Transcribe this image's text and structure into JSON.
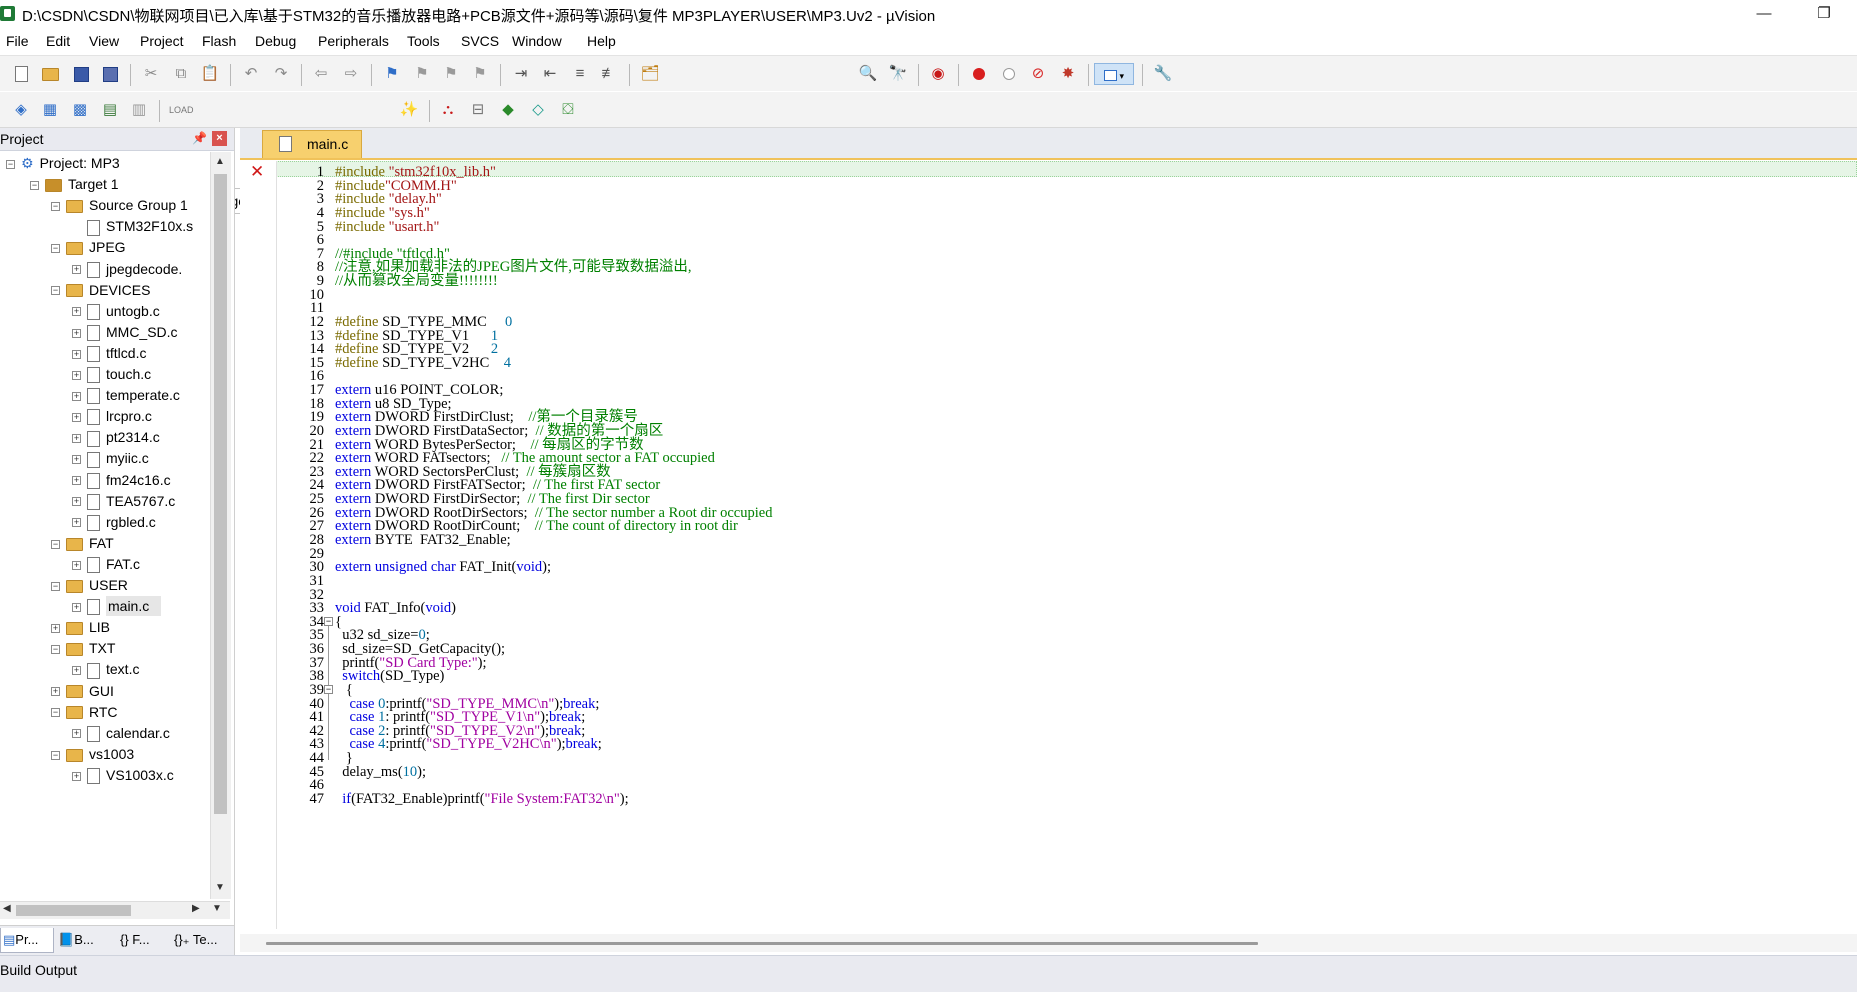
{
  "window": {
    "title": "D:\\CSDN\\CSDN\\物联网项目\\已入库\\基于STM32的音乐播放器电路+PCB源文件+源码等\\源码\\复件 MP3PLAYER\\USER\\MP3.Uv2 - µVision",
    "minimize": "—",
    "restore": "❐"
  },
  "menu": [
    "File",
    "Edit",
    "View",
    "Project",
    "Flash",
    "Debug",
    "Peripherals",
    "Tools",
    "SVCS",
    "Window",
    "Help"
  ],
  "toolbar2": {
    "target": "Target 1"
  },
  "project_panel": {
    "title": "Project",
    "pin": "📌",
    "close": "×",
    "tabs": [
      "Pr...",
      "B...",
      "{} F...",
      "{}₊ Te..."
    ],
    "tree": [
      {
        "label": "Project: MP3",
        "level": 0,
        "type": "project",
        "expander": "−"
      },
      {
        "label": "Target 1",
        "level": 1,
        "type": "target",
        "expander": "−"
      },
      {
        "label": "Source Group 1",
        "level": 2,
        "type": "folder",
        "expander": "−"
      },
      {
        "label": "STM32F10x.s",
        "level": 3,
        "type": "file",
        "expander": ""
      },
      {
        "label": "JPEG",
        "level": 2,
        "type": "folder",
        "expander": "−"
      },
      {
        "label": "jpegdecode.",
        "level": 3,
        "type": "file",
        "expander": "+"
      },
      {
        "label": "DEVICES",
        "level": 2,
        "type": "folder",
        "expander": "−"
      },
      {
        "label": "untogb.c",
        "level": 3,
        "type": "file",
        "expander": "+"
      },
      {
        "label": "MMC_SD.c",
        "level": 3,
        "type": "file",
        "expander": "+"
      },
      {
        "label": "tftlcd.c",
        "level": 3,
        "type": "file",
        "expander": "+"
      },
      {
        "label": "touch.c",
        "level": 3,
        "type": "file",
        "expander": "+"
      },
      {
        "label": "temperate.c",
        "level": 3,
        "type": "file",
        "expander": "+"
      },
      {
        "label": "lrcpro.c",
        "level": 3,
        "type": "file",
        "expander": "+"
      },
      {
        "label": "pt2314.c",
        "level": 3,
        "type": "file",
        "expander": "+"
      },
      {
        "label": "myiic.c",
        "level": 3,
        "type": "file",
        "expander": "+"
      },
      {
        "label": "fm24c16.c",
        "level": 3,
        "type": "file",
        "expander": "+"
      },
      {
        "label": "TEA5767.c",
        "level": 3,
        "type": "file",
        "expander": "+"
      },
      {
        "label": "rgbled.c",
        "level": 3,
        "type": "file",
        "expander": "+"
      },
      {
        "label": "FAT",
        "level": 2,
        "type": "folder",
        "expander": "−"
      },
      {
        "label": "FAT.c",
        "level": 3,
        "type": "file",
        "expander": "+"
      },
      {
        "label": "USER",
        "level": 2,
        "type": "folder",
        "expander": "−"
      },
      {
        "label": "main.c",
        "level": 3,
        "type": "file",
        "expander": "+",
        "selected": true
      },
      {
        "label": "LIB",
        "level": 2,
        "type": "folder",
        "expander": "+"
      },
      {
        "label": "TXT",
        "level": 2,
        "type": "folder",
        "expander": "−"
      },
      {
        "label": "text.c",
        "level": 3,
        "type": "file",
        "expander": "+"
      },
      {
        "label": "GUI",
        "level": 2,
        "type": "folder",
        "expander": "+"
      },
      {
        "label": "RTC",
        "level": 2,
        "type": "folder",
        "expander": "−"
      },
      {
        "label": "calendar.c",
        "level": 3,
        "type": "file",
        "expander": "+"
      },
      {
        "label": "vs1003",
        "level": 2,
        "type": "folder",
        "expander": "−"
      },
      {
        "label": "VS1003x.c",
        "level": 3,
        "type": "file",
        "expander": "+"
      }
    ]
  },
  "editor": {
    "tab": "main.c",
    "lines": [
      [
        [
          "pp",
          "#include "
        ],
        [
          "s",
          "\"stm32f10x_lib.h\""
        ]
      ],
      [
        [
          "pp",
          "#include"
        ],
        [
          "s",
          "\"COMM.H\""
        ]
      ],
      [
        [
          "pp",
          "#include "
        ],
        [
          "s",
          "\"delay.h\""
        ]
      ],
      [
        [
          "pp",
          "#include "
        ],
        [
          "s",
          "\"sys.h\""
        ]
      ],
      [
        [
          "pp",
          "#include "
        ],
        [
          "s",
          "\"usart.h\""
        ]
      ],
      [],
      [
        [
          "cm",
          "//#include \"tftlcd.h\""
        ]
      ],
      [
        [
          "cm",
          "//注意,如果加载非法的JPEG图片文件,可能导致数据溢出,"
        ]
      ],
      [
        [
          "cm",
          "//从而篡改全局变量!!!!!!!!"
        ]
      ],
      [],
      [],
      [
        [
          "pp",
          "#define "
        ],
        [
          "",
          "SD_TYPE_MMC     "
        ],
        [
          "n",
          "0"
        ]
      ],
      [
        [
          "pp",
          "#define "
        ],
        [
          "",
          "SD_TYPE_V1      "
        ],
        [
          "n",
          "1"
        ]
      ],
      [
        [
          "pp",
          "#define "
        ],
        [
          "",
          "SD_TYPE_V2      "
        ],
        [
          "n",
          "2"
        ]
      ],
      [
        [
          "pp",
          "#define "
        ],
        [
          "",
          "SD_TYPE_V2HC    "
        ],
        [
          "n",
          "4"
        ]
      ],
      [],
      [
        [
          "k",
          "extern "
        ],
        [
          "",
          "u16 POINT_COLOR;"
        ]
      ],
      [
        [
          "k",
          "extern "
        ],
        [
          "",
          "u8 SD_Type;"
        ]
      ],
      [
        [
          "k",
          "extern "
        ],
        [
          "",
          "DWORD FirstDirClust;    "
        ],
        [
          "cm",
          "//第一个目录簇号"
        ]
      ],
      [
        [
          "k",
          "extern "
        ],
        [
          "",
          "DWORD FirstDataSector;  "
        ],
        [
          "cm",
          "// 数据的第一个扇区"
        ]
      ],
      [
        [
          "k",
          "extern "
        ],
        [
          "",
          "WORD BytesPerSector;    "
        ],
        [
          "cm",
          "// 每扇区的字节数"
        ]
      ],
      [
        [
          "k",
          "extern "
        ],
        [
          "",
          "WORD FATsectors;   "
        ],
        [
          "cm",
          "// The amount sector a FAT occupied"
        ]
      ],
      [
        [
          "k",
          "extern "
        ],
        [
          "",
          "WORD SectorsPerClust;  "
        ],
        [
          "cm",
          "// 每簇扇区数"
        ]
      ],
      [
        [
          "k",
          "extern "
        ],
        [
          "",
          "DWORD FirstFATSector;  "
        ],
        [
          "cm",
          "// The first FAT sector"
        ]
      ],
      [
        [
          "k",
          "extern "
        ],
        [
          "",
          "DWORD FirstDirSector;  "
        ],
        [
          "cm",
          "// The first Dir sector"
        ]
      ],
      [
        [
          "k",
          "extern "
        ],
        [
          "",
          "DWORD RootDirSectors;  "
        ],
        [
          "cm",
          "// The sector number a Root dir occupied"
        ]
      ],
      [
        [
          "k",
          "extern "
        ],
        [
          "",
          "DWORD RootDirCount;    "
        ],
        [
          "cm",
          "// The count of directory in root dir"
        ]
      ],
      [
        [
          "k",
          "extern "
        ],
        [
          "",
          "BYTE  FAT32_Enable;"
        ]
      ],
      [],
      [
        [
          "k",
          "extern unsigned char "
        ],
        [
          "",
          "FAT_Init("
        ],
        [
          "k",
          "void"
        ],
        [
          "",
          ");"
        ]
      ],
      [],
      [],
      [
        [
          "k",
          "void "
        ],
        [
          "",
          "FAT_Info("
        ],
        [
          "k",
          "void"
        ],
        [
          "",
          ")"
        ]
      ],
      [
        [
          "",
          "{"
        ]
      ],
      [
        [
          "",
          "  u32 sd_size="
        ],
        [
          "n",
          "0"
        ],
        [
          "",
          ";"
        ]
      ],
      [
        [
          "",
          "  sd_size=SD_GetCapacity();"
        ]
      ],
      [
        [
          "",
          "  printf("
        ],
        [
          "str",
          "\"SD Card Type:\""
        ],
        [
          "",
          ");"
        ]
      ],
      [
        [
          "k",
          "  switch"
        ],
        [
          "",
          "(SD_Type)"
        ]
      ],
      [
        [
          "",
          "   {"
        ]
      ],
      [
        [
          "k",
          "    case "
        ],
        [
          "n",
          "0"
        ],
        [
          "",
          ":printf("
        ],
        [
          "str",
          "\"SD_TYPE_MMC\\n\""
        ],
        [
          "",
          ");"
        ],
        [
          "k",
          "break"
        ],
        [
          "",
          ";"
        ]
      ],
      [
        [
          "k",
          "    case "
        ],
        [
          "n",
          "1"
        ],
        [
          "",
          ": printf("
        ],
        [
          "str",
          "\"SD_TYPE_V1\\n\""
        ],
        [
          "",
          ");"
        ],
        [
          "k",
          "break"
        ],
        [
          "",
          ";"
        ]
      ],
      [
        [
          "k",
          "    case "
        ],
        [
          "n",
          "2"
        ],
        [
          "",
          ": printf("
        ],
        [
          "str",
          "\"SD_TYPE_V2\\n\""
        ],
        [
          "",
          ");"
        ],
        [
          "k",
          "break"
        ],
        [
          "",
          ";"
        ]
      ],
      [
        [
          "k",
          "    case "
        ],
        [
          "n",
          "4"
        ],
        [
          "",
          ":printf("
        ],
        [
          "str",
          "\"SD_TYPE_V2HC\\n\""
        ],
        [
          "",
          ");"
        ],
        [
          "k",
          "break"
        ],
        [
          "",
          ";"
        ]
      ],
      [
        [
          "",
          "   }"
        ]
      ],
      [
        [
          "",
          "  delay_ms("
        ],
        [
          "n",
          "10"
        ],
        [
          "",
          ");"
        ]
      ],
      [],
      [
        [
          "k",
          "  if"
        ],
        [
          "",
          "(FAT32_Enable)printf("
        ],
        [
          "str",
          "\"File System:FAT32\\n\""
        ],
        [
          "",
          ");"
        ]
      ]
    ]
  },
  "build_output": {
    "title": "Build Output"
  }
}
